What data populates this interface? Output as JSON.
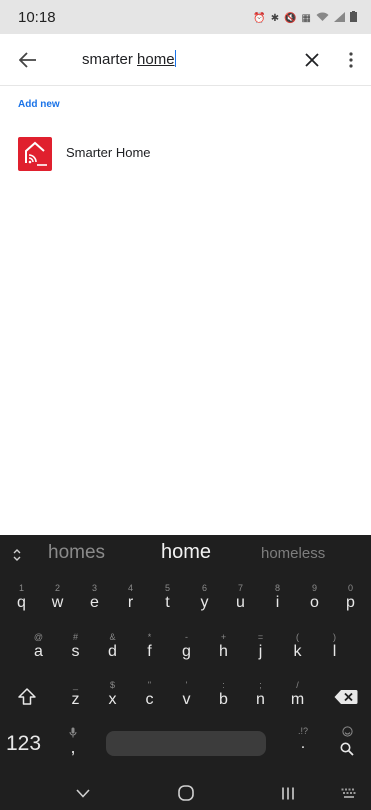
{
  "status_bar": {
    "time": "10:18",
    "icons": [
      "alarm-icon",
      "bluetooth-icon",
      "mute-icon",
      "volte-icon",
      "wifi-icon",
      "signal-icon",
      "battery-icon"
    ]
  },
  "search": {
    "query_prefix": "smarter ",
    "query_composing": "home"
  },
  "section_label": "Add new",
  "results": [
    {
      "name": "Smarter Home",
      "icon": "smarter-home-app-icon",
      "icon_color": "#e0202e"
    }
  ],
  "keyboard": {
    "suggestions": {
      "left": "homes",
      "middle": "home",
      "right": "homeless"
    },
    "row1": [
      {
        "hint": "1",
        "key": "q"
      },
      {
        "hint": "2",
        "key": "w"
      },
      {
        "hint": "3",
        "key": "e"
      },
      {
        "hint": "4",
        "key": "r"
      },
      {
        "hint": "5",
        "key": "t"
      },
      {
        "hint": "6",
        "key": "y"
      },
      {
        "hint": "7",
        "key": "u"
      },
      {
        "hint": "8",
        "key": "i"
      },
      {
        "hint": "9",
        "key": "o"
      },
      {
        "hint": "0",
        "key": "p"
      }
    ],
    "row2": [
      {
        "hint": "@",
        "key": "a"
      },
      {
        "hint": "#",
        "key": "s"
      },
      {
        "hint": "&",
        "key": "d"
      },
      {
        "hint": "*",
        "key": "f"
      },
      {
        "hint": "-",
        "key": "g"
      },
      {
        "hint": "+",
        "key": "h"
      },
      {
        "hint": "=",
        "key": "j"
      },
      {
        "hint": "(",
        "key": "k"
      },
      {
        "hint": ")",
        "key": "l"
      }
    ],
    "row3": [
      {
        "hint": "_",
        "key": "z"
      },
      {
        "hint": "$",
        "key": "x"
      },
      {
        "hint": "\"",
        "key": "c"
      },
      {
        "hint": "'",
        "key": "v"
      },
      {
        "hint": ":",
        "key": "b"
      },
      {
        "hint": ";",
        "key": "n"
      },
      {
        "hint": "/",
        "key": "m"
      }
    ],
    "num_label": "123",
    "comma_label": ",",
    "period_hint": ".!?",
    "period_label": "."
  },
  "colors": {
    "accent": "#1a73e8",
    "keyboard_bg": "#1f1f1f",
    "status_bar_bg": "#e5e5e5"
  }
}
